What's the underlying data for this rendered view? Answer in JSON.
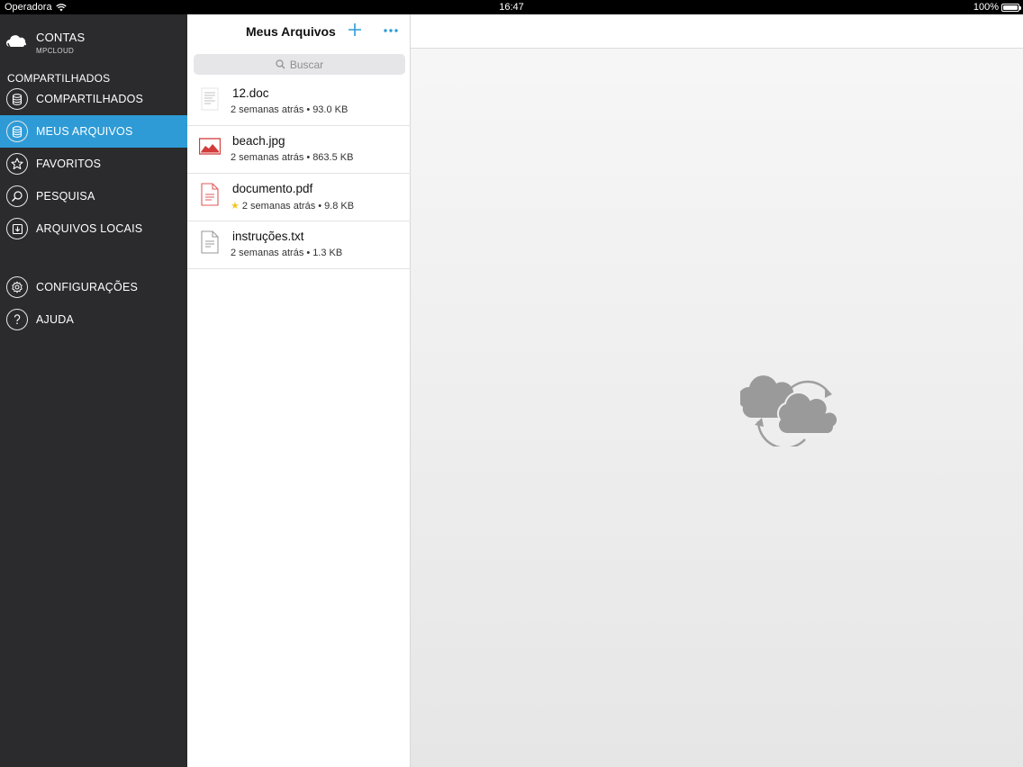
{
  "statusbar": {
    "carrier": "Operadora",
    "time": "16:47",
    "battery": "100%"
  },
  "sidebar": {
    "account": {
      "name": "CONTAS",
      "sub": "MPCLOUD"
    },
    "section_title": "COMPARTILHADOS",
    "items": [
      {
        "label": "COMPARTILHADOS",
        "icon": "database-icon"
      },
      {
        "label": "MEUS ARQUIVOS",
        "icon": "database-icon",
        "active": true
      },
      {
        "label": "FAVORITOS",
        "icon": "star-icon"
      },
      {
        "label": "PESQUISA",
        "icon": "search-icon"
      },
      {
        "label": "ARQUIVOS LOCAIS",
        "icon": "download-icon"
      },
      {
        "label": "CONFIGURAÇÕES",
        "icon": "gear-icon"
      },
      {
        "label": "AJUDA",
        "icon": "help-icon"
      }
    ],
    "accent": "#2e9bd6"
  },
  "listpane": {
    "title": "Meus Arquivos",
    "search_placeholder": "Buscar",
    "files": [
      {
        "name": "12.doc",
        "date": "2 semanas atrás",
        "size": "93.0 KB",
        "icon": "doc-icon",
        "favorite": false
      },
      {
        "name": "beach.jpg",
        "date": "2 semanas atrás",
        "size": "863.5 KB",
        "icon": "image-icon",
        "favorite": false
      },
      {
        "name": "documento.pdf",
        "date": "2 semanas atrás",
        "size": "9.8 KB",
        "icon": "pdf-icon",
        "favorite": true
      },
      {
        "name": "instruções.txt",
        "date": "2 semanas atrás",
        "size": "1.3 KB",
        "icon": "txt-icon",
        "favorite": false
      }
    ],
    "separator": "•"
  }
}
